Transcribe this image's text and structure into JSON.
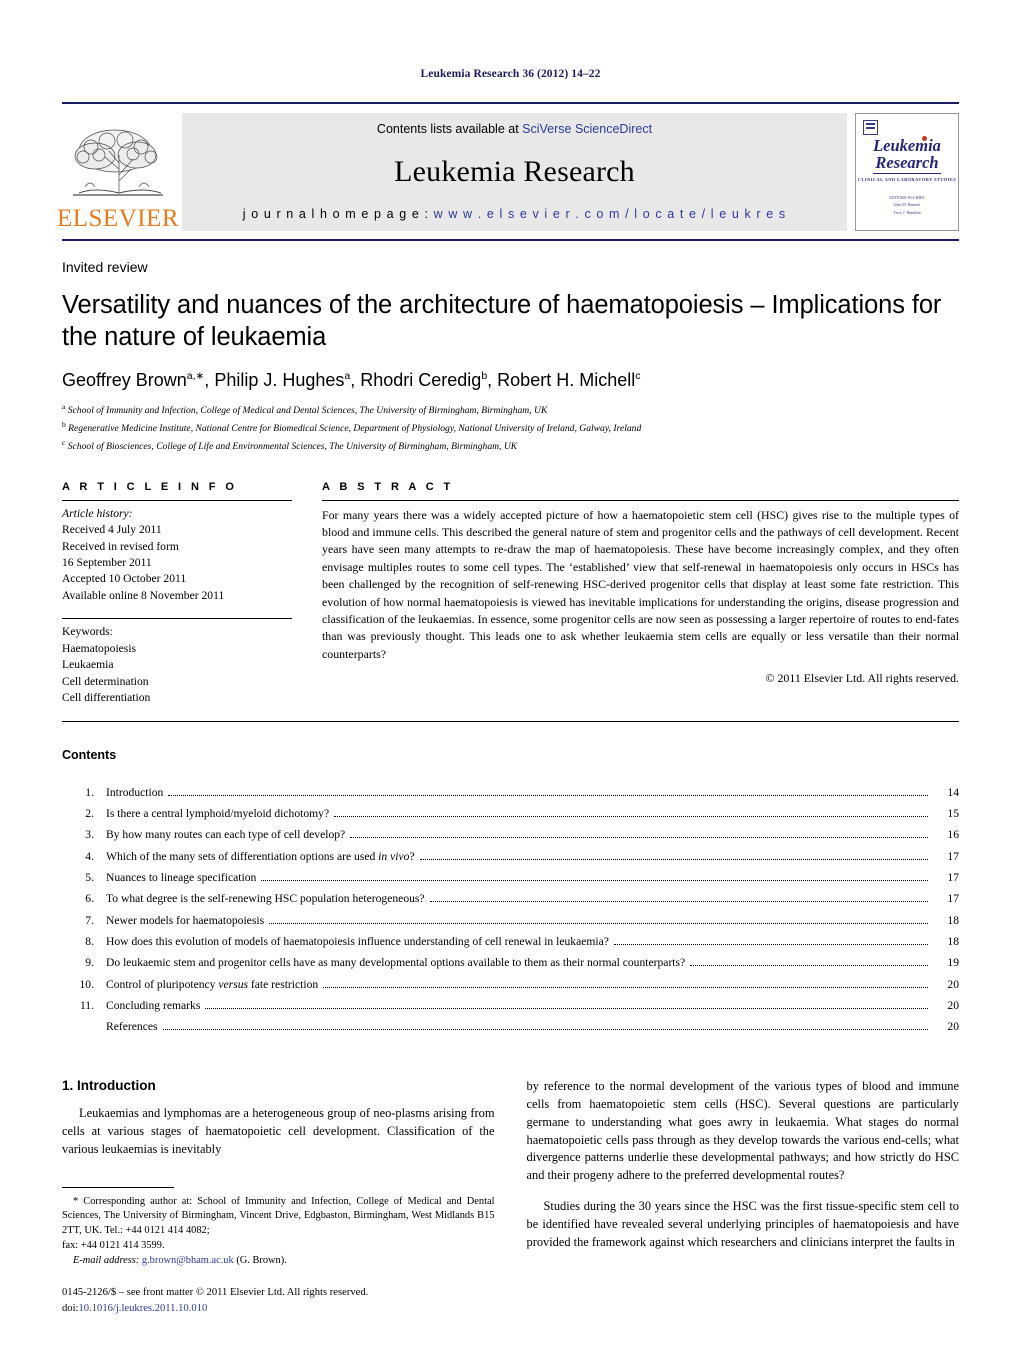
{
  "running_head": "Leukemia Research 36 (2012) 14–22",
  "masthead": {
    "contents_prefix": "Contents lists available at ",
    "contents_link": "SciVerse ScienceDirect",
    "journal_name": "Leukemia Research",
    "homepage_label": "j o u r n a l   h o m e p a g e :",
    "homepage_url": "w w w . e l s e v i e r . c o m / l o c a t e / l e u k r e s",
    "publisher": "ELSEVIER",
    "cover_title_line1": "Leukemia",
    "cover_title_line2": "Research",
    "cover_subtitle": "CLINICAL AND LABORATORY STUDIES",
    "cover_editors_label": "EDITORS-IN-CHIEF",
    "cover_editor_1": "John M. Bennett",
    "cover_editor_2": "Terry J. Hamblin",
    "link_color": "#2b3a9c",
    "brand_color": "#e87b1e",
    "rule_color": "#1a1a5e"
  },
  "article": {
    "doctype": "Invited review",
    "title": "Versatility and nuances of the architecture of haematopoiesis – Implications for the nature of leukaemia",
    "authors": [
      {
        "name": "Geoffrey Brown",
        "sup": "a,∗"
      },
      {
        "name": "Philip J. Hughes",
        "sup": "a"
      },
      {
        "name": "Rhodri Ceredig",
        "sup": "b"
      },
      {
        "name": "Robert H. Michell",
        "sup": "c"
      }
    ],
    "affiliations": [
      {
        "mark": "a",
        "text": "School of Immunity and Infection, College of Medical and Dental Sciences, The University of Birmingham, Birmingham, UK"
      },
      {
        "mark": "b",
        "text": "Regenerative Medicine Institute, National Centre for Biomedical Science, Department of Physiology, National University of Ireland, Galway, Ireland"
      },
      {
        "mark": "c",
        "text": "School of Biosciences, College of Life and Environmental Sciences, The University of Birmingham, Birmingham, UK"
      }
    ]
  },
  "info": {
    "heading": "A R T I C L E   I N F O",
    "history_label": "Article history:",
    "history": [
      "Received 4 July 2011",
      "Received in revised form",
      "16 September 2011",
      "Accepted 10 October 2011",
      "Available online 8 November 2011"
    ],
    "keywords_label": "Keywords:",
    "keywords": [
      "Haematopoiesis",
      "Leukaemia",
      "Cell determination",
      "Cell differentiation"
    ]
  },
  "abstract": {
    "heading": "A B S T R A C T",
    "text": "For many years there was a widely accepted picture of how a haematopoietic stem cell (HSC) gives rise to the multiple types of blood and immune cells. This described the general nature of stem and progenitor cells and the pathways of cell development. Recent years have seen many attempts to re-draw the map of haematopoiesis. These have become increasingly complex, and they often envisage multiples routes to some cell types. The ‘established’ view that self-renewal in haematopoiesis only occurs in HSCs has been challenged by the recognition of self-renewing HSC-derived progenitor cells that display at least some fate restriction. This evolution of how normal haematopoiesis is viewed has inevitable implications for understanding the origins, disease progression and classification of the leukaemias. In essence, some progenitor cells are now seen as possessing a larger repertoire of routes to end-fates than was previously thought. This leads one to ask whether leukaemia stem cells are equally or less versatile than their normal counterparts?",
    "copyright": "© 2011 Elsevier Ltd. All rights reserved."
  },
  "contents": {
    "heading": "Contents",
    "items": [
      {
        "num": "1.",
        "label": "Introduction",
        "page": "14"
      },
      {
        "num": "2.",
        "label": "Is there a central lymphoid/myeloid dichotomy?",
        "page": "15"
      },
      {
        "num": "3.",
        "label": "By how many routes can each type of cell develop?",
        "page": "16"
      },
      {
        "num": "4.",
        "label": "Which of the many sets of differentiation options are used in vivo?",
        "page": "17",
        "italic": "in vivo"
      },
      {
        "num": "5.",
        "label": "Nuances to lineage specification",
        "page": "17"
      },
      {
        "num": "6.",
        "label": "To what degree is the self-renewing HSC population heterogeneous?",
        "page": "17"
      },
      {
        "num": "7.",
        "label": "Newer models for haematopoiesis",
        "page": "18"
      },
      {
        "num": "8.",
        "label": "How does this evolution of models of haematopoiesis influence understanding of cell renewal in leukaemia?",
        "page": "18"
      },
      {
        "num": "9.",
        "label": "Do leukaemic stem and progenitor cells have as many developmental options available to them as their normal counterparts?",
        "page": "19"
      },
      {
        "num": "10.",
        "label": "Control of pluripotency versus fate restriction",
        "page": "20",
        "italic": "versus"
      },
      {
        "num": "11.",
        "label": "Concluding remarks",
        "page": "20"
      },
      {
        "num": "",
        "label": "References",
        "page": "20"
      }
    ]
  },
  "body": {
    "section_number": "1.",
    "section_title": "Introduction",
    "left_para_1": "Leukaemias and lymphomas are a heterogeneous group of neo-plasms arising from cells at various stages of haematopoietic cell development. Classification of the various leukaemias is inevitably",
    "right_para_1": "by reference to the normal development of the various types of blood and immune cells from haematopoietic stem cells (HSC). Several questions are particularly germane to understanding what goes awry in leukaemia. What stages do normal haematopoietic cells pass through as they develop towards the various end-cells; what divergence patterns underlie these developmental pathways; and how strictly do HSC and their progeny adhere to the preferred developmental routes?",
    "right_para_2": "Studies during the 30 years since the HSC was the first tissue-specific stem cell to be identified have revealed several underlying principles of haematopoiesis and have provided the framework against which researchers and clinicians interpret the faults in"
  },
  "footnote": {
    "corresponding": "* Corresponding author at: School of Immunity and Infection, College of Medical and Dental Sciences, The University of Birmingham, Vincent Drive, Edgbaston, Birmingham, West Midlands B15 2TT, UK. Tel.: +44 0121 414 4082;",
    "fax": "fax: +44 0121 414 3599.",
    "email_label": "E-mail address:",
    "email": "g.brown@bham.ac.uk",
    "email_owner": "(G. Brown)."
  },
  "imprint": {
    "line1": "0145-2126/$ – see front matter © 2011 Elsevier Ltd. All rights reserved.",
    "doi_label": "doi:",
    "doi": "10.1016/j.leukres.2011.10.010"
  }
}
